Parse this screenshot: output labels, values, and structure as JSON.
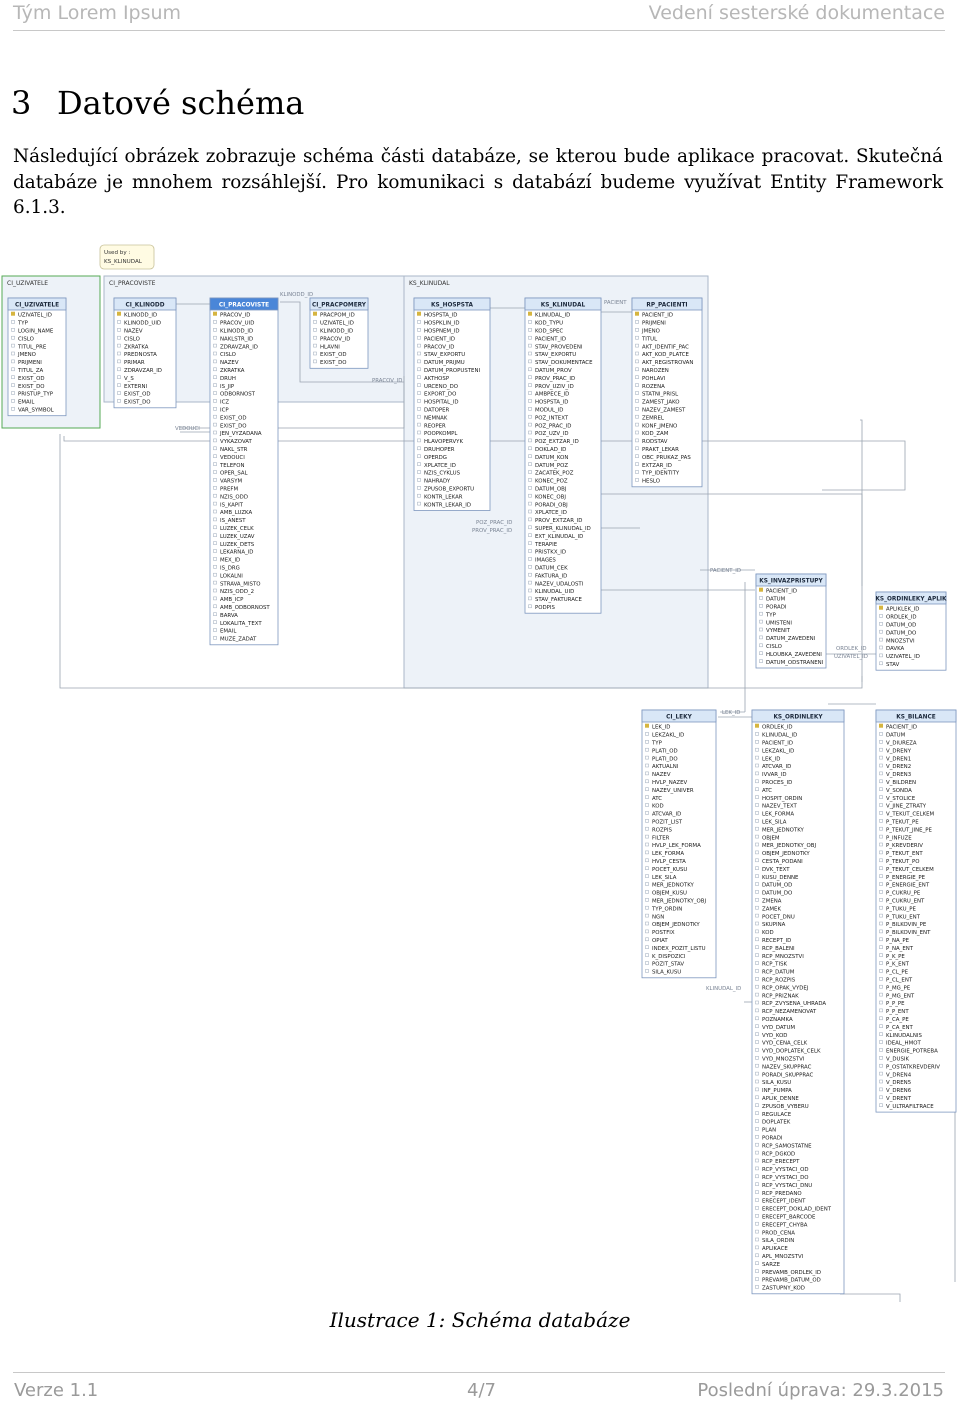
{
  "header": {
    "team": "Tým Lorem Ipsum",
    "doc": "Vedení sesterské dokumentace"
  },
  "chapter": {
    "number": "3",
    "title": "Datové schéma"
  },
  "paragraph": "Následující obrázek zobrazuje schéma části databáze, se kterou bude aplikace pracovat. Skutečná databáze je mnohem rozsáhlejší. Pro komunikaci s databází budeme využívat Entity Framework 6.1.3.",
  "figure": {
    "caption": "Ilustrace 1: Schéma databáze",
    "used_by": "Used by :",
    "used_by_value": "KS_KLINUDAL",
    "colors": {
      "header": "#d9e7f7",
      "table_border": "#7d97bf",
      "selected_header": "#4a86d8",
      "group_fill": "#edf2f8",
      "group_border": "#aab7c8",
      "key_icon": "#d6b540",
      "cl_group_border": "#55aa55"
    },
    "groups": [
      {
        "label": "CI_UZIVATELE"
      },
      {
        "label": "CI_PRACOVISTE"
      },
      {
        "label": "KS_KLINUDAL"
      }
    ],
    "tables": [
      {
        "name": "CI_UZIVATELE",
        "fields": [
          "UZIVATEL_ID",
          "TYP",
          "LOGIN_NAME",
          "CISLO",
          "TITUL_PRE",
          "JMENO",
          "PRIJMENI",
          "TITUL_ZA",
          "EXIST_OD",
          "EXIST_DO",
          "PRISTUP_TYP",
          "EMAIL",
          "VAR_SYMBOL"
        ]
      },
      {
        "name": "CI_KLINODD",
        "fields": [
          "KLINODD_ID",
          "KLINODD_UID",
          "NAZEV",
          "CISLO",
          "ZKRATKA",
          "PREDNOSTA",
          "PRIMAR",
          "ZDRAVZAR_ID",
          "V_S",
          "EXTERNI",
          "EXIST_OD",
          "EXIST_DO"
        ]
      },
      {
        "name": "CI_PRACOVISTE",
        "fields": [
          "PRACOV_ID",
          "PRACOV_UID",
          "KLINODD_ID",
          "NAKLSTR_ID",
          "ZDRAVZAR_ID",
          "CISLO",
          "NAZEV",
          "ZKRATKA",
          "DRUH",
          "IS_JIP",
          "ODBORNOST",
          "ICZ",
          "ICP",
          "EXIST_OD",
          "EXIST_DO",
          "JEN_VYZADANA",
          "VYKAZOVAT",
          "NAKL_STR",
          "VEDOUCI",
          "TELEFON",
          "OPER_SAL",
          "VARSYM",
          "PREFM",
          "NZIS_ODD",
          "IS_KAPIT",
          "AMB_LUZKA",
          "IS_ANEST",
          "LUZEK_CELK",
          "LUZEK_UZAV",
          "LUZEK_DETS",
          "LEKARNA_ID",
          "MEX_ID",
          "IS_DRG",
          "LOKALNI",
          "STRAVA_MISTO",
          "NZIS_ODD_2",
          "AMB_ICP",
          "AMB_ODBORNOST",
          "BARVA",
          "LOKALITA_TEXT",
          "EMAIL",
          "MUZE_ZADAT"
        ]
      },
      {
        "name": "CI_PRACPOMERY",
        "fields": [
          "PRACPOM_ID",
          "UZIVATEL_ID",
          "KLINODD_ID",
          "PRACOV_ID",
          "HLAVNI",
          "EXIST_OD",
          "EXIST_DO"
        ]
      },
      {
        "name": "KS_HOSPSTA",
        "fields": [
          "HOSPSTA_ID",
          "HOSPKLIN_ID",
          "HOSPNEM_ID",
          "PACIENT_ID",
          "PRACOV_ID",
          "STAV_EXPORTU",
          "DATUM_PRIJMU",
          "DATUM_PROPUSTENI",
          "AKTHOSP",
          "URCENO_DO",
          "EXPORT_DO",
          "HOSPITAL_ID",
          "DATOPER",
          "NEMNAK",
          "REOPER",
          "POOPKOMPL",
          "HLAVOPERVYK",
          "DRUHOPER",
          "OPERDG",
          "XPLATCE_ID",
          "NZIS_CYKLUS",
          "NAHRADY",
          "ZPUSOB_EXPORTU",
          "KONTR_LEKAR",
          "KONTR_LEKAR_ID"
        ]
      },
      {
        "name": "KS_KLINUDAL",
        "fields": [
          "KLINUDAL_ID",
          "KOD_TYPU",
          "KOD_SPEC",
          "PACIENT_ID",
          "STAV_PROVEDENI",
          "STAV_EXPORTU",
          "STAV_DOKUMENTACE",
          "DATUM_PROV",
          "PROV_PRAC_ID",
          "PROV_UZIV_ID",
          "AMBPECE_ID",
          "HOSPSTA_ID",
          "MODUL_ID",
          "POZ_INTEXT",
          "POZ_PRAC_ID",
          "POZ_UZV_ID",
          "POZ_EXTZAR_ID",
          "DOKLAD_ID",
          "DATUM_KON",
          "DATUM_POZ",
          "ZACATEK_POZ",
          "KONEC_POZ",
          "DATUM_OBJ",
          "KONEC_OBJ",
          "PORADI_OBJ",
          "XPLATCE_ID",
          "PROV_EXTZAR_ID",
          "SUPER_KLINUDAL_ID",
          "EXT_KLINUDAL_ID",
          "TERAPIE",
          "PRISTKX_ID",
          "IMAGES",
          "DATUM_CEK",
          "FAKTURA_ID",
          "NAZEV_UDALOSTI",
          "KLINUDAL_UID",
          "STAV_FAKTURACE",
          "PODPIS"
        ]
      },
      {
        "name": "RP_PACIENTI",
        "fields": [
          "PACIENT_ID",
          "PRIJMENI",
          "JMENO",
          "TITUL",
          "AKT_IDENTIF_PAC",
          "AKT_KOD_PLATCE",
          "AKT_REGISTROVAN",
          "NAROZEN",
          "POHLAVI",
          "ROZENA",
          "STATNI_PRISL",
          "ZAMEST_JAKO",
          "NAZEV_ZAMEST",
          "ZEMREL",
          "KONF_JMENO",
          "KOD_ZAM",
          "RODSTAV",
          "PRAKT_LEKAR",
          "OBC_PRUKAZ_PAS",
          "EXTZAR_ID",
          "TYP_IDENTITY",
          "HESLO"
        ]
      },
      {
        "name": "KS_INVAZPRISTUPY",
        "fields": [
          "PACIENT_ID",
          "DATUM",
          "PORADI",
          "TYP",
          "UMISTENI",
          "VYMENIT",
          "DATUM_ZAVEDENI",
          "CISLO",
          "HLOUBKA_ZAVEDENI",
          "DATUM_ODSTRANENI"
        ]
      },
      {
        "name": "KS_ORDINLEKY_APLIK",
        "fields": [
          "APLIKLEK_ID",
          "ORDLEK_ID",
          "DATUM_OD",
          "DATUM_DO",
          "MNOZSTVI",
          "DAVKA",
          "UZIVATEL_ID",
          "STAV"
        ]
      },
      {
        "name": "CI_LEKY",
        "fields": [
          "LEK_ID",
          "LEKZAKL_ID",
          "TYP",
          "PLATI_OD",
          "PLATI_DO",
          "AKTUALNI",
          "NAZEV",
          "HVLP_NAZEV",
          "NAZEV_UNIVER",
          "ATC",
          "KOD",
          "ATCVAR_ID",
          "POZIT_LIST",
          "ROZPIS",
          "FILTER",
          "HVLP_LEK_FORMA",
          "LEK_FORMA",
          "HVLP_CESTA",
          "POCET_KUSU",
          "LEK_SILA",
          "MER_JEDNOTKY",
          "OBJEM_KUSU",
          "MER_JEDNOTKY_OBJ",
          "TYP_ORDIN",
          "NGN",
          "OBJEM_JEDNOTKY",
          "POSTFIX",
          "OPIAT",
          "INDEX_POZIT_LISTU",
          "K_DISPOZICI",
          "POZIT_STAV",
          "SILA_KUSU"
        ]
      },
      {
        "name": "KS_ORDINLEKY",
        "fields": [
          "ORDLEK_ID",
          "KLINUDAL_ID",
          "PACIENT_ID",
          "LEKZAKL_ID",
          "LEK_ID",
          "ATCVAR_ID",
          "IVVAR_ID",
          "PROCES_ID",
          "ATC",
          "HOSPIT_ORDIN",
          "NAZEV_TEXT",
          "LEK_FORMA",
          "LEK_SILA",
          "MER_JEDNOTKY",
          "OBJEM",
          "MER_JEDNOTKY_OBJ",
          "OBJEM_JEDNOTKY",
          "CESTA_PODANI",
          "DVK_TEXT",
          "KUSU_DENNE",
          "DATUM_OD",
          "DATUM_DO",
          "ZMENA",
          "ZAMEK",
          "POCET_DNU",
          "SKUPINA",
          "KOD",
          "RECEPT_ID",
          "RCP_BALENI",
          "RCP_MNOZSTVI",
          "RCP_TISK",
          "RCP_DATUM",
          "RCP_ROZPIS",
          "RCP_OPAK_VYDEJ",
          "RCP_PRIZNAK",
          "RCP_ZVYSENA_UHRADA",
          "RCP_NEZAMENOVAT",
          "POZNAMKA",
          "VYD_DATUM",
          "VYD_KOD",
          "VYD_CENA_CELK",
          "VYD_DOPLATEK_CELK",
          "VYD_MNOZSTVI",
          "NAZEV_SKUPPRAC",
          "PORADI_SKUPPRAC",
          "SILA_KUSU",
          "INF_PUMPA",
          "APLIK_DENNE",
          "ZPUSOB_VYBERU",
          "REGULACE",
          "DOPLATEK",
          "PLAN",
          "PORADI",
          "RCP_SAMOSTATNE",
          "RCP_DGKOD",
          "RCP_ERECEPT",
          "RCP_VYSTACI_OD",
          "RCP_VYSTACI_DO",
          "RCP_VYSTACI_DNU",
          "RCP_PREDANO",
          "ERECEPT_IDENT",
          "ERECEPT_DOKLAD_IDENT",
          "ERECEPT_BARCODE",
          "ERECEPT_CHYBA",
          "PROD_CENA",
          "SILA_ORDIN",
          "APLIKACE",
          "APL_MNOZSTVI",
          "SARZE",
          "PREVAMB_ORDLEK_ID",
          "PREVAMB_DATUM_OD",
          "ZASTUPNY_KOD"
        ]
      },
      {
        "name": "KS_BILANCE",
        "fields": [
          "PACIENT_ID",
          "DATUM",
          "V_DIUREZA",
          "V_DRENY",
          "V_DREN1",
          "V_DREN2",
          "V_DREN3",
          "V_BILDREN",
          "V_SONDA",
          "V_STOLICE",
          "V_JINE_ZTRATY",
          "V_TEKUT_CELKEM",
          "P_TEKUT_PE",
          "P_TEKUT_JINE_PE",
          "P_INFUZE",
          "P_KREVDERIV",
          "P_TEKUT_ENT",
          "P_TEKUT_PO",
          "P_TEKUT_CELKEM",
          "P_ENERGIE_PE",
          "P_ENERGIE_ENT",
          "P_CUKRU_PE",
          "P_CUKRU_ENT",
          "P_TUKU_PE",
          "P_TUKU_ENT",
          "P_BILKOVIN_PE",
          "P_BILKOVIN_ENT",
          "P_NA_PE",
          "P_NA_ENT",
          "P_K_PE",
          "P_K_ENT",
          "P_CL_PE",
          "P_CL_ENT",
          "P_MG_PE",
          "P_MG_ENT",
          "P_P_PE",
          "P_P_ENT",
          "P_CA_PE",
          "P_CA_ENT",
          "KLINUDALNIS",
          "IDEAL_HMOT",
          "ENERGIE_POTREBA",
          "V_DUSIK",
          "P_OSTATKREVDERIV",
          "V_DREN4",
          "V_DREN5",
          "V_DREN6",
          "V_DRENT",
          "V_ULTRAFILTRACE"
        ]
      }
    ],
    "relation_labels": [
      "KLINODD_ID",
      "PRACOV_ID",
      "VEDOUCI",
      "PACIENT_ID",
      "PACIENT",
      "POZ_PRAC_ID",
      "PROV_PRAC_ID",
      "LEK_ID",
      "KLINUDAL_ID",
      "ORDLEK_ID",
      "UZIVATEL_ID"
    ]
  },
  "footer": {
    "version": "Verze 1.1",
    "page": "4/7",
    "updated": "Poslední úprava: 29.3.2015"
  }
}
